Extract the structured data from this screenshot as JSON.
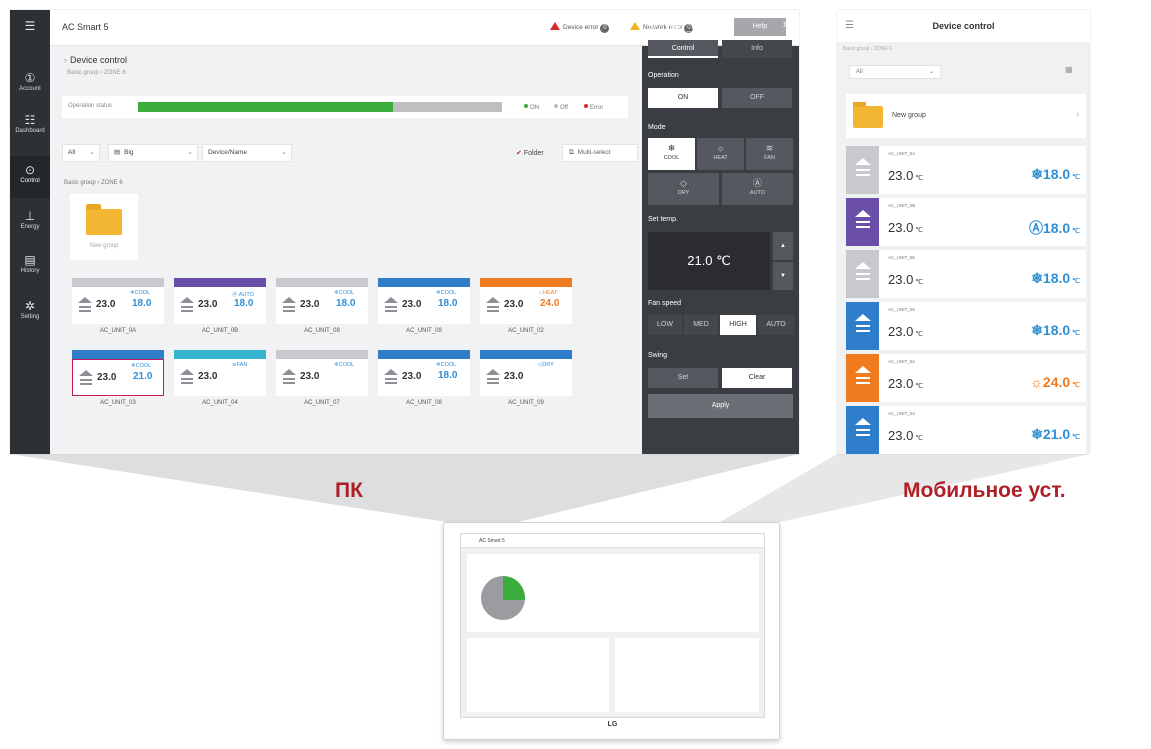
{
  "labels": {
    "pc": "ПК",
    "mobile": "Мобильное уст."
  },
  "pc": {
    "app_title": "AC Smart 5",
    "device_error": "Device error",
    "device_error_count": "0",
    "network_error": "Network error",
    "network_error_count": "0",
    "help": "Help",
    "rail": [
      {
        "label": "Account",
        "icon": "①"
      },
      {
        "label": "Dashboard",
        "icon": "☷"
      },
      {
        "label": "Control",
        "icon": "⊙"
      },
      {
        "label": "Energy",
        "icon": "⊥"
      },
      {
        "label": "History",
        "icon": "▤"
      },
      {
        "label": "Setting",
        "icon": "✲"
      }
    ],
    "page_title": "Device control",
    "breadcrumb": "Basic group  ›  ZONE 6",
    "operation_status_label": "Operation status",
    "operation_on_fraction": 0.7,
    "legend": {
      "on": "ON",
      "off": "Off",
      "error": "Error"
    },
    "filters": {
      "all": "All",
      "size": "Big",
      "device": "Device/Name"
    },
    "folder": "Folder",
    "multi_select": "Multi-select",
    "group_path": "Basic group  ›  ZONE 6",
    "new_group": "New group",
    "units": [
      {
        "name": "AC_UNIT_0A",
        "cur": "23.0",
        "mode": "❄COOL",
        "set": "18.0",
        "head": "#c7c9cc",
        "setcolor": "#2f8fd5"
      },
      {
        "name": "AC_UNIT_0B",
        "cur": "23.0",
        "mode": "Ⓐ AUTO",
        "set": "18.0",
        "head": "#6a4ea8",
        "setcolor": "#2f8fd5"
      },
      {
        "name": "AC_UNIT_08",
        "cur": "23.0",
        "mode": "❄COOL",
        "set": "18.0",
        "head": "#c7c9cc",
        "setcolor": "#2f8fd5"
      },
      {
        "name": "AC_UNIT_09",
        "cur": "23.0",
        "mode": "❄COOL",
        "set": "18.0",
        "head": "#2f7ecb",
        "setcolor": "#2f8fd5"
      },
      {
        "name": "AC_UNIT_02",
        "cur": "23.0",
        "mode": "☼HEAT",
        "set": "24.0",
        "head": "#f07a1e",
        "setcolor": "#f07a1e"
      },
      {
        "name": "AC_UNIT_03",
        "cur": "23.0",
        "mode": "❄COOL",
        "set": "21.0",
        "head": "#2f7ecb",
        "setcolor": "#2f8fd5"
      },
      {
        "name": "AC_UNIT_04",
        "cur": "23.0",
        "mode": "≋FAN",
        "set": "",
        "head": "#36b4cf",
        "setcolor": "#2f8fd5"
      },
      {
        "name": "AC_UNIT_07",
        "cur": "23.0",
        "mode": "❄COOL",
        "set": "",
        "head": "#c7c9cc",
        "setcolor": "#2f8fd5"
      },
      {
        "name": "AC_UNIT_08",
        "cur": "23.0",
        "mode": "❄COOL",
        "set": "18.0",
        "head": "#2f7ecb",
        "setcolor": "#2f8fd5"
      },
      {
        "name": "AC_UNIT_09",
        "cur": "23.0",
        "mode": "◇DRY",
        "set": "",
        "head": "#2f7ecb",
        "setcolor": "#2f8fd5"
      }
    ],
    "panel": {
      "unit": "AC_UNIT_03",
      "tab_control": "Control",
      "tab_info": "Info",
      "operation": "Operation",
      "on": "ON",
      "off": "OFF",
      "mode": "Mode",
      "modes": [
        "COOL",
        "HEAT",
        "FAN",
        "DRY",
        "AUTO"
      ],
      "set_temp": "Set temp.",
      "temp_value": "21.0 ℃",
      "fan_speed": "Fan speed",
      "fan": [
        "LOW",
        "MED",
        "HIGH",
        "AUTO"
      ],
      "swing": "Swing",
      "set": "Set",
      "clear": "Clear",
      "apply": "Apply"
    }
  },
  "mobile": {
    "title": "Device control",
    "breadcrumb": "Basic group  ›  ZONE 6",
    "filter": "All",
    "new_group": "New group",
    "items": [
      {
        "name": "AC_UNIT_0A",
        "cur": "23.0",
        "set": "❄18.0",
        "icon_color": "#c7c9cc",
        "set_color": "#2f8fd5"
      },
      {
        "name": "AC_UNIT_0B",
        "cur": "23.0",
        "set": "Ⓐ18.0",
        "icon_color": "#6a4ea8",
        "set_color": "#2f8fd5"
      },
      {
        "name": "AC_UNIT_08",
        "cur": "23.0",
        "set": "❄18.0",
        "icon_color": "#c7c9cc",
        "set_color": "#2f8fd5"
      },
      {
        "name": "AC_UNIT_09",
        "cur": "23.0",
        "set": "❄18.0",
        "icon_color": "#2f7ecb",
        "set_color": "#2f8fd5"
      },
      {
        "name": "AC_UNIT_02",
        "cur": "23.0",
        "set": "☼24.0",
        "icon_color": "#f07a1e",
        "set_color": "#f07a1e"
      },
      {
        "name": "AC_UNIT_03",
        "cur": "23.0",
        "set": "❄21.0",
        "icon_color": "#2f7ecb",
        "set_color": "#2f8fd5"
      }
    ]
  },
  "monitor": {
    "app_title": "AC Smart 5",
    "brand": "LG"
  },
  "colors": {
    "label_red": "#b11f26",
    "green": "#3aad3d",
    "panel": "#3a3d42"
  }
}
